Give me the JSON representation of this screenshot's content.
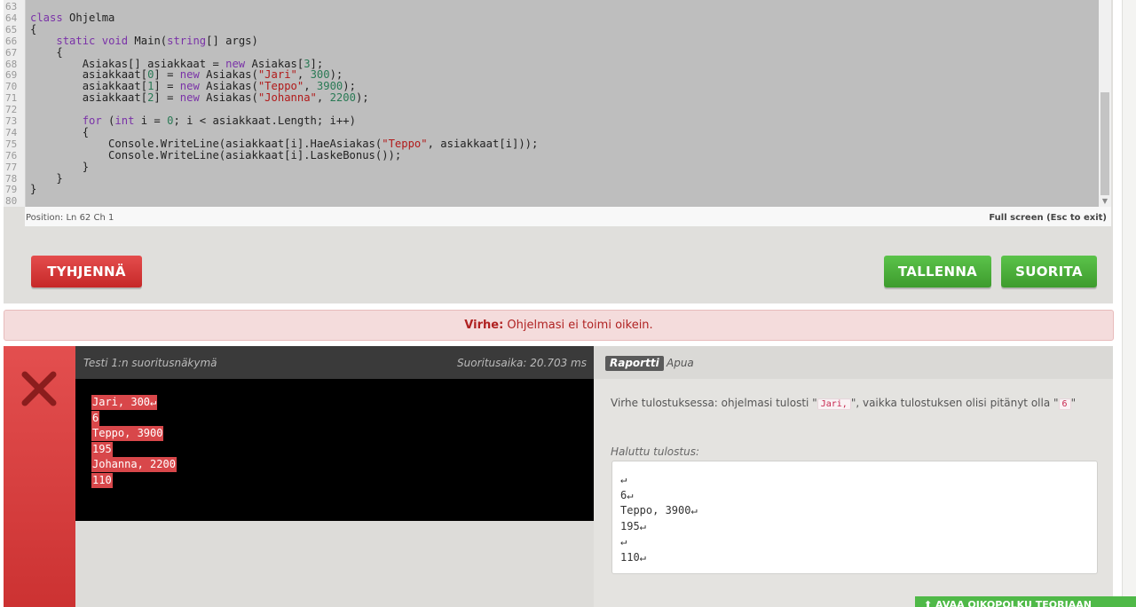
{
  "editor": {
    "lines": [
      {
        "n": "63",
        "html": ""
      },
      {
        "n": "64",
        "html": "<span class=\"kw\">class</span> Ohjelma"
      },
      {
        "n": "65",
        "html": "{"
      },
      {
        "n": "66",
        "html": "    <span class=\"kw\">static</span> <span class=\"kw\">void</span> Main(<span class=\"kw\">string</span>[] args)"
      },
      {
        "n": "67",
        "html": "    {"
      },
      {
        "n": "68",
        "html": "        Asiakas[] asiakkaat = <span class=\"kw\">new</span> Asiakas[<span class=\"num\">3</span>];"
      },
      {
        "n": "69",
        "html": "        asiakkaat[<span class=\"num\">0</span>] = <span class=\"kw\">new</span> Asiakas(<span class=\"str\">\"Jari\"</span>, <span class=\"num\">300</span>);"
      },
      {
        "n": "70",
        "html": "        asiakkaat[<span class=\"num\">1</span>] = <span class=\"kw\">new</span> Asiakas(<span class=\"str\">\"Teppo\"</span>, <span class=\"num\">3900</span>);"
      },
      {
        "n": "71",
        "html": "        asiakkaat[<span class=\"num\">2</span>] = <span class=\"kw\">new</span> Asiakas(<span class=\"str\">\"Johanna\"</span>, <span class=\"num\">2200</span>);"
      },
      {
        "n": "72",
        "html": ""
      },
      {
        "n": "73",
        "html": "        <span class=\"kw\">for</span> (<span class=\"kw\">int</span> i = <span class=\"num\">0</span>; i &lt; asiakkaat.Length; i++)"
      },
      {
        "n": "74",
        "html": "        {"
      },
      {
        "n": "75",
        "html": "            Console.WriteLine(asiakkaat[i].HaeAsiakas(<span class=\"str\">\"Teppo\"</span>, asiakkaat[i]));"
      },
      {
        "n": "76",
        "html": "            Console.WriteLine(asiakkaat[i].LaskeBonus());"
      },
      {
        "n": "77",
        "html": "        }"
      },
      {
        "n": "78",
        "html": "    }"
      },
      {
        "n": "79",
        "html": "}"
      },
      {
        "n": "80",
        "html": ""
      }
    ],
    "status_position": "Position: Ln 62 Ch 1",
    "status_fullscreen": "Full screen (Esc to exit)"
  },
  "buttons": {
    "clear": "TYHJENNÄ",
    "save": "TALLENNA",
    "run": "SUORITA"
  },
  "alert": {
    "label": "Virhe:",
    "message": " Ohjelmasi ei toimi oikein."
  },
  "test": {
    "title": "Testi 1:n suoritusnäkymä",
    "time": "Suoritusaika: 20.703 ms",
    "output": [
      "Jari, 300↵",
      "6",
      "Teppo, 3900",
      "195",
      "Johanna, 2200",
      "110"
    ]
  },
  "report": {
    "tab_active": "Raportti",
    "tab_help": "Apua",
    "text_before": "Virhe tulostuksessa: ohjelmasi tulosti \"",
    "printed": "Jari,",
    "text_mid": "\", vaikka tulostuksen olisi pitänyt olla \"",
    "expected_value": "6",
    "text_after": "\"",
    "expected_label": "Haluttu tulostus:",
    "expected_lines": [
      "↵",
      "6↵",
      "Teppo, 3900↵",
      "195↵",
      "↵",
      "110↵"
    ]
  },
  "footer": {
    "theory_button": "⬆ AVAA OIKOPOLKU TEORIAAN"
  }
}
